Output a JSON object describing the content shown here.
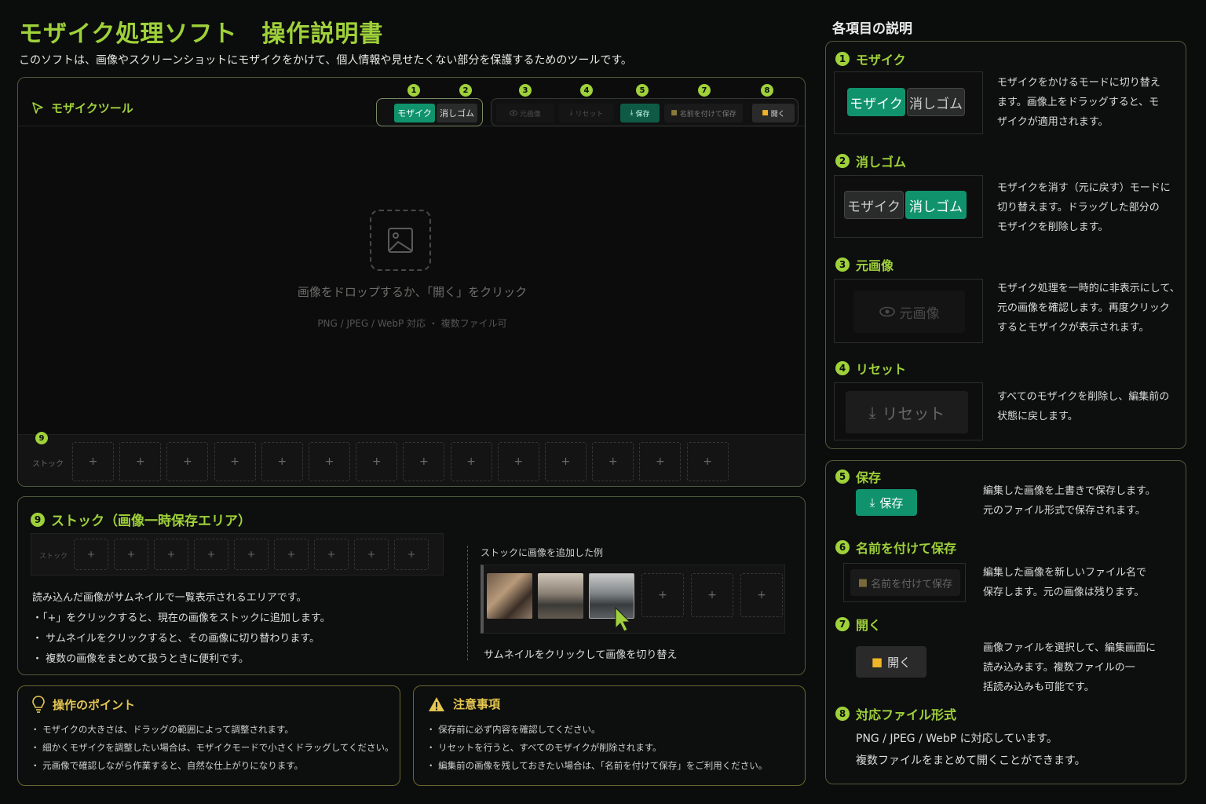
{
  "header": {
    "title": "モザイク処理ソフト　操作説明書",
    "subtitle": "このソフトは、画像やスクリーンショットにモザイクをかけて、個人情報や見せたくない部分を保護するためのツールです。"
  },
  "tool": {
    "title": "モザイクツール",
    "numbers": [
      "1",
      "2",
      "3",
      "4",
      "5",
      "7",
      "8"
    ],
    "mode_mosaic": "モザイク",
    "mode_eraser": "消しゴム",
    "btn_original": "元画像",
    "btn_reset": "リセット",
    "btn_save": "保存",
    "btn_save_as": "名前を付けて保存",
    "btn_open": "開く",
    "drop_message": "画像をドロップするか、「開く」をクリック",
    "drop_sub": "PNG / JPEG / WebP 対応 ・ 複数ファイル可",
    "stock_number": "9",
    "stock_label": "ストック",
    "slot_plus": "+"
  },
  "stock_section": {
    "number": "9",
    "title": "ストック（画像一時保存エリア）",
    "mini_label": "ストック",
    "desc": "読み込んだ画像がサムネイルで一覧表示されるエリアです。",
    "bullets": [
      "・「+」をクリックすると、現在の画像をストックに追加します。",
      "・ サムネイルをクリックすると、その画像に切り替わります。",
      "・ 複数の画像をまとめて扱うときに便利です。"
    ],
    "example_label": "ストックに画像を追加した例",
    "example_caption": "サムネイルをクリックして画像を切り替え"
  },
  "tips": {
    "title": "操作のポイント",
    "items": [
      "・ モザイクの大きさは、ドラッグの範囲によって調整されます。",
      "・ 細かくモザイクを調整したい場合は、モザイクモードで小さくドラッグしてください。",
      "・ 元画像で確認しながら作業すると、自然な仕上がりになります。"
    ]
  },
  "caution": {
    "title": "注意事項",
    "items": [
      "・ 保存前に必ず内容を確認してください。",
      "・ リセットを行うと、すべてのモザイクが削除されます。",
      "・ 編集前の画像を残しておきたい場合は、「名前を付けて保存」をご利用ください。"
    ]
  },
  "right": {
    "heading": "各項目の説明",
    "items": [
      {
        "num": "1",
        "title": "モザイク",
        "desc": [
          "モザイクをかけるモードに切り替え",
          "ます。画像上をドラッグすると、モ",
          "ザイクが適用されます。"
        ]
      },
      {
        "num": "2",
        "title": "消しゴム",
        "desc": [
          "モザイクを消す（元に戻す）モードに",
          "切り替えます。ドラッグした部分の",
          "モザイクを削除します。"
        ]
      },
      {
        "num": "3",
        "title": "元画像",
        "desc": [
          "モザイク処理を一時的に非表示にして、",
          "元の画像を確認します。再度クリック",
          "するとモザイクが表示されます。"
        ]
      },
      {
        "num": "4",
        "title": "リセット",
        "desc": [
          "すべてのモザイクを削除し、編集前の",
          "状態に戻します。"
        ]
      },
      {
        "num": "5",
        "title": "保存",
        "desc": [
          "編集した画像を上書きで保存します。",
          "元のファイル形式で保存されます。"
        ]
      },
      {
        "num": "6",
        "title": "名前を付けて保存",
        "desc": [
          "編集した画像を新しいファイル名で",
          "保存します。元の画像は残ります。"
        ]
      },
      {
        "num": "7",
        "title": "開く",
        "desc": [
          "画像ファイルを選択して、編集画面に",
          "読み込みます。複数ファイルの一",
          "括読み込みも可能です。"
        ]
      },
      {
        "num": "8",
        "title": "対応ファイル形式",
        "desc": [
          "PNG / JPEG / WebP に対応しています。",
          "複数ファイルをまとめて開くことができます。"
        ]
      }
    ]
  },
  "colors": {
    "accent": "#9fd13a",
    "button_green": "#10936d",
    "warning": "#e4c650",
    "background": "#0b0d0c"
  }
}
